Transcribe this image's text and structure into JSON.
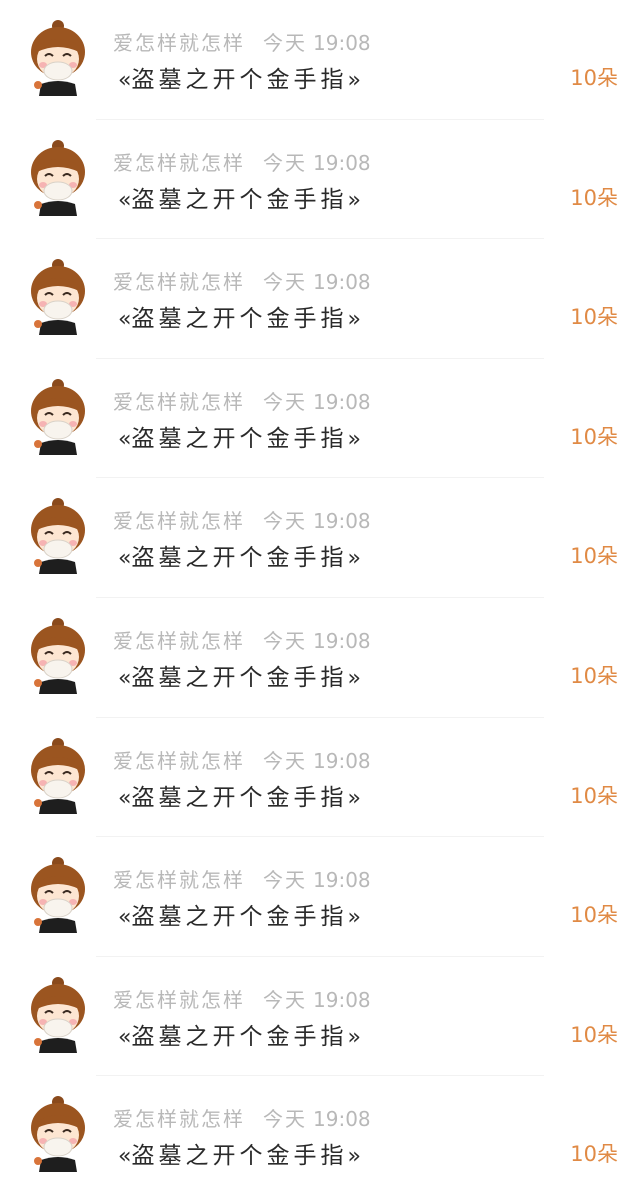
{
  "items": [
    {
      "user": "爱怎样就怎样",
      "time_label": "今天",
      "time": "19:08",
      "book": "盗墓之开个金手指",
      "quote_open": "«",
      "quote_close": "»",
      "count_num": "10",
      "count_unit": "朵"
    },
    {
      "user": "爱怎样就怎样",
      "time_label": "今天",
      "time": "19:08",
      "book": "盗墓之开个金手指",
      "quote_open": "«",
      "quote_close": "»",
      "count_num": "10",
      "count_unit": "朵"
    },
    {
      "user": "爱怎样就怎样",
      "time_label": "今天",
      "time": "19:08",
      "book": "盗墓之开个金手指",
      "quote_open": "«",
      "quote_close": "»",
      "count_num": "10",
      "count_unit": "朵"
    },
    {
      "user": "爱怎样就怎样",
      "time_label": "今天",
      "time": "19:08",
      "book": "盗墓之开个金手指",
      "quote_open": "«",
      "quote_close": "»",
      "count_num": "10",
      "count_unit": "朵"
    },
    {
      "user": "爱怎样就怎样",
      "time_label": "今天",
      "time": "19:08",
      "book": "盗墓之开个金手指",
      "quote_open": "«",
      "quote_close": "»",
      "count_num": "10",
      "count_unit": "朵"
    },
    {
      "user": "爱怎样就怎样",
      "time_label": "今天",
      "time": "19:08",
      "book": "盗墓之开个金手指",
      "quote_open": "«",
      "quote_close": "»",
      "count_num": "10",
      "count_unit": "朵"
    },
    {
      "user": "爱怎样就怎样",
      "time_label": "今天",
      "time": "19:08",
      "book": "盗墓之开个金手指",
      "quote_open": "«",
      "quote_close": "»",
      "count_num": "10",
      "count_unit": "朵"
    },
    {
      "user": "爱怎样就怎样",
      "time_label": "今天",
      "time": "19:08",
      "book": "盗墓之开个金手指",
      "quote_open": "«",
      "quote_close": "»",
      "count_num": "10",
      "count_unit": "朵"
    },
    {
      "user": "爱怎样就怎样",
      "time_label": "今天",
      "time": "19:08",
      "book": "盗墓之开个金手指",
      "quote_open": "«",
      "quote_close": "»",
      "count_num": "10",
      "count_unit": "朵"
    },
    {
      "user": "爱怎样就怎样",
      "time_label": "今天",
      "time": "19:08",
      "book": "盗墓之开个金手指",
      "quote_open": "«",
      "quote_close": "»",
      "count_num": "10",
      "count_unit": "朵"
    }
  ],
  "colors": {
    "username": "#b8b8b8",
    "title": "#2a2a2a",
    "count": "#e08a45",
    "divider": "#f2f2f2"
  },
  "icons": {
    "avatar": "cartoon-avatar-icon"
  }
}
